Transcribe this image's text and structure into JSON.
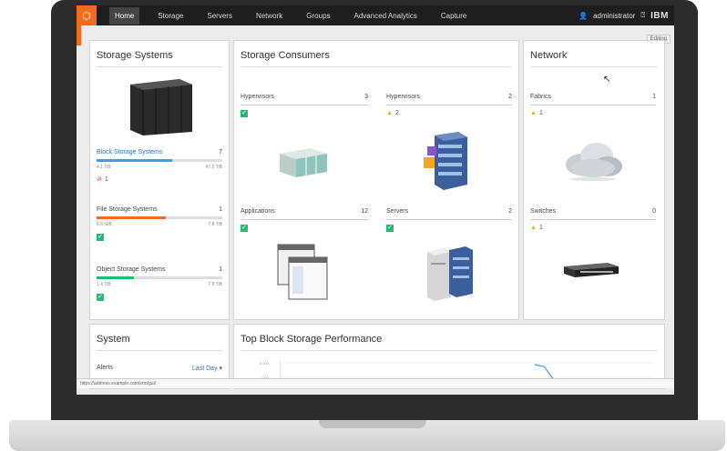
{
  "nav": {
    "items": [
      "Home",
      "Storage",
      "Servers",
      "Network",
      "Groups",
      "Advanced Analytics",
      "Capture"
    ],
    "active_index": 0,
    "user": "administrator",
    "help_icon": "help-icon",
    "brand": "IBM"
  },
  "edit_label": "Editing",
  "storage_systems": {
    "title": "Storage Systems",
    "block": {
      "label": "Block Storage Systems",
      "count": "7",
      "used": "4.1 TiB",
      "total": "47.0 TiB",
      "error_count": "1",
      "fill_percent": 60,
      "color": "#3f9fd8"
    },
    "file": {
      "label": "File Storage Systems",
      "count": "1",
      "used": "8.6 GiB",
      "total": "7.8 TiB",
      "fill_percent": 55,
      "color": "#f26b21"
    },
    "object": {
      "label": "Object Storage Systems",
      "count": "1",
      "used": "1.4 TiB",
      "total": "7.8 TiB",
      "fill_percent": 30,
      "color": "#2bb673"
    }
  },
  "storage_consumers": {
    "title": "Storage Consumers",
    "hypervisors_a": {
      "label": "Hypervisors",
      "count": "3"
    },
    "hypervisors_b": {
      "label": "Hypervisors",
      "count": "2",
      "warn_count": "2"
    },
    "applications": {
      "label": "Applications",
      "count": "12"
    },
    "servers": {
      "label": "Servers",
      "count": "2"
    }
  },
  "network": {
    "title": "Network",
    "fabrics": {
      "label": "Fabrics",
      "count": "1",
      "warn_count": "1"
    },
    "switches": {
      "label": "Switches",
      "count": "0",
      "warn_count": "1"
    }
  },
  "system": {
    "title": "System",
    "alerts_label": "Alerts",
    "alerts_link": "Last Day ▾"
  },
  "performance": {
    "title": "Top Block Storage Performance",
    "y_top": "2,000",
    "y_mid": "1,000"
  },
  "status_url": "https://address.example.com/srm/gui/"
}
